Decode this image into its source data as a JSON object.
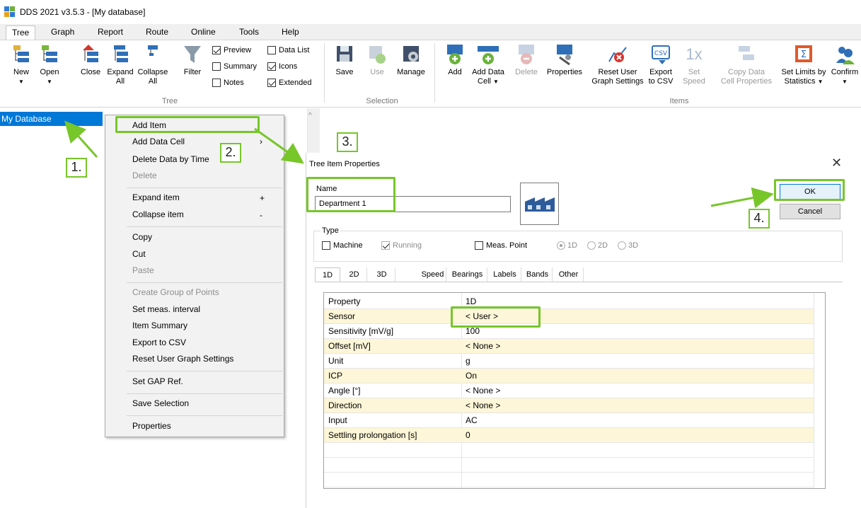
{
  "window": {
    "title": "DDS 2021 v3.5.3 - [My database]"
  },
  "menu_tabs": [
    "Tree",
    "Graph",
    "Report",
    "Route",
    "Online",
    "Tools",
    "Help"
  ],
  "ribbon": {
    "tree_group": {
      "label": "Tree",
      "buttons": {
        "new": "New",
        "open": "Open",
        "close": "Close",
        "expand": "Expand",
        "expand2": "All",
        "collapse": "Collapse",
        "collapse2": "All",
        "filter": "Filter"
      },
      "checkboxes": {
        "preview": "Preview",
        "summary": "Summary",
        "notes": "Notes",
        "data_list": "Data List",
        "icons": "Icons",
        "extended": "Extended"
      }
    },
    "selection_group": {
      "label": "Selection",
      "buttons": {
        "save": "Save",
        "use": "Use",
        "manage": "Manage"
      }
    },
    "items_group": {
      "label": "Items",
      "buttons": {
        "add": "Add",
        "add_data": "Add Data",
        "add_data2": "Cell",
        "delete": "Delete",
        "properties": "Properties",
        "reset_user": "Reset User",
        "reset_user2": "Graph Settings",
        "export": "Export",
        "export2": "to CSV",
        "set": "Set",
        "set2": "Speed",
        "copy_data": "Copy Data",
        "copy_data2": "Cell Properties",
        "set_limits": "Set Limits by",
        "set_limits2": "Statistics",
        "confirm": "Confirm",
        "csv_glyph": "CSV",
        "speed_glyph": "1x",
        "sigma_glyph": "Σ"
      }
    }
  },
  "tree": {
    "selected_item": "My Database"
  },
  "context_menu": {
    "items": {
      "add_item": "Add Item",
      "add_data_cell": "Add Data Cell",
      "delete_by_time": "Delete Data by Time",
      "delete": "Delete",
      "expand_item": "Expand item",
      "collapse_item": "Collapse item",
      "copy": "Copy",
      "cut": "Cut",
      "paste": "Paste",
      "create_group": "Create Group of Points",
      "set_interval": "Set meas. interval",
      "item_summary": "Item Summary",
      "export_csv": "Export to CSV",
      "reset_user": "Reset User Graph Settings",
      "set_gap": "Set GAP Ref.",
      "save_selection": "Save Selection",
      "properties": "Properties",
      "expand_shortcut": "+",
      "collapse_shortcut": "-",
      "submenu_arrow": "›"
    }
  },
  "dialog": {
    "title": "Tree Item Properties",
    "close_glyph": "✕",
    "name_label": "Name",
    "name_value": "Department 1",
    "ok": "OK",
    "cancel": "Cancel",
    "type_label": "Type",
    "machine": "Machine",
    "running": "Running",
    "meas_point": "Meas. Point",
    "radios": [
      "1D",
      "2D",
      "3D"
    ],
    "tabs": [
      "1D",
      "2D",
      "3D",
      "Speed",
      "Bearings",
      "Labels",
      "Bands",
      "Other"
    ],
    "grid": {
      "header": {
        "property": "Property",
        "value": "1D"
      },
      "rows": [
        {
          "property": "Sensor",
          "value": "< User >"
        },
        {
          "property": "Sensitivity [mV/g]",
          "value": "100"
        },
        {
          "property": "Offset [mV]",
          "value": "< None >"
        },
        {
          "property": "Unit",
          "value": "g"
        },
        {
          "property": "ICP",
          "value": "On"
        },
        {
          "property": "Angle [°]",
          "value": "< None >"
        },
        {
          "property": "Direction",
          "value": "< None >"
        },
        {
          "property": "Input",
          "value": "AC"
        },
        {
          "property": "Settling prolongation [s]",
          "value": "0"
        }
      ]
    }
  },
  "annotations": {
    "step1": "1.",
    "step2": "2.",
    "step3": "3.",
    "step4": "4."
  },
  "colors": {
    "accent_green": "#77c62a",
    "selection_blue": "#0078d7",
    "row_highlight": "#fdf6d8"
  }
}
